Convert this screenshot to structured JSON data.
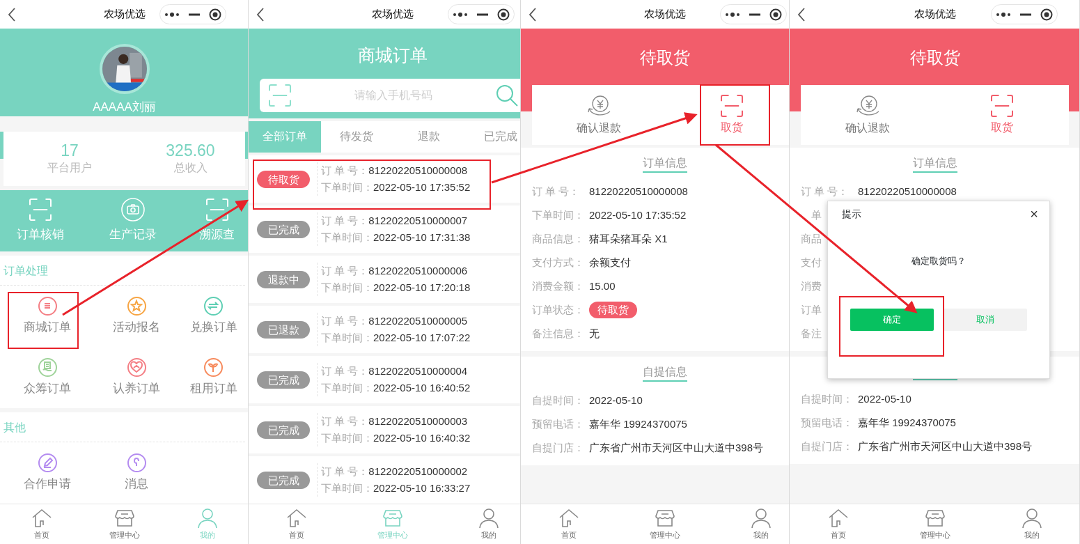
{
  "panels": [
    {
      "kind": "profile",
      "header": {
        "title": "农场优选"
      },
      "profile": {
        "name": "AAAAA刘丽"
      },
      "stats": [
        {
          "value": "17",
          "label": "平台用户"
        },
        {
          "value": "325.60",
          "label": "总收入"
        }
      ],
      "quick_actions": [
        {
          "kind": "scan",
          "label": "订单核销"
        },
        {
          "kind": "camera",
          "label": "生产记录"
        },
        {
          "kind": "scan",
          "label": "溯源查"
        }
      ],
      "sections": [
        {
          "title": "订单处理",
          "items": [
            {
              "kind": "list",
              "label": "商城订单",
              "color": "#f47f85"
            },
            {
              "kind": "star",
              "label": "活动报名",
              "color": "#f7a544"
            },
            {
              "kind": "swap",
              "label": "兑换订单",
              "color": "#5fcfb4"
            },
            {
              "kind": "receipt",
              "label": "众筹订单",
              "color": "#9fd39a"
            },
            {
              "kind": "heart",
              "label": "认养订单",
              "color": "#f47f85"
            },
            {
              "kind": "sprout",
              "label": "租用订单",
              "color": "#f78a5c"
            }
          ]
        },
        {
          "title": "其他",
          "items": [
            {
              "kind": "pen",
              "label": "合作申请",
              "color": "#b48cf0"
            },
            {
              "kind": "bell",
              "label": "消息",
              "color": "#b48cf0"
            }
          ]
        }
      ],
      "tabbar": [
        {
          "label": "首页",
          "selected": false
        },
        {
          "label": "管理中心",
          "selected": false
        },
        {
          "label": "我的",
          "selected": true
        }
      ]
    },
    {
      "kind": "orders",
      "header": {
        "title": "农场优选"
      },
      "title": "商城订单",
      "search": {
        "placeholder": "请输入手机号码"
      },
      "tabs": [
        {
          "label": "全部订单",
          "selected": true
        },
        {
          "label": "待发货",
          "selected": false
        },
        {
          "label": "退款",
          "selected": false
        },
        {
          "label": "已完成",
          "selected": false
        }
      ],
      "orders": [
        {
          "status": "待取货",
          "color": "#f25d6b",
          "number_label": "订 单 号：",
          "number": "81220220510000008",
          "time_label": "下单时间：",
          "time": "2022-05-10 17:35:52"
        },
        {
          "status": "已完成",
          "color": "#999999",
          "number_label": "订 单 号：",
          "number": "81220220510000007",
          "time_label": "下单时间：",
          "time": "2022-05-10 17:31:38"
        },
        {
          "status": "退款中",
          "color": "#999999",
          "number_label": "订 单 号：",
          "number": "81220220510000006",
          "time_label": "下单时间：",
          "time": "2022-05-10 17:20:18"
        },
        {
          "status": "已退款",
          "color": "#999999",
          "number_label": "订 单 号：",
          "number": "81220220510000005",
          "time_label": "下单时间：",
          "time": "2022-05-10 17:07:22"
        },
        {
          "status": "已完成",
          "color": "#999999",
          "number_label": "订 单 号：",
          "number": "81220220510000004",
          "time_label": "下单时间：",
          "time": "2022-05-10 16:40:52"
        },
        {
          "status": "已完成",
          "color": "#999999",
          "number_label": "订 单 号：",
          "number": "81220220510000003",
          "time_label": "下单时间：",
          "time": "2022-05-10 16:40:32"
        },
        {
          "status": "已完成",
          "color": "#999999",
          "number_label": "订 单 号：",
          "number": "81220220510000002",
          "time_label": "下单时间：",
          "time": "2022-05-10 16:33:27"
        }
      ],
      "tabbar": [
        {
          "label": "首页",
          "selected": false
        },
        {
          "label": "管理中心",
          "selected": true
        },
        {
          "label": "我的",
          "selected": false
        }
      ]
    },
    {
      "kind": "detail",
      "header": {
        "title": "农场优选"
      },
      "title": "待取货",
      "actions": [
        {
          "kind": "refund",
          "label": "确认退款",
          "color": "#777777"
        },
        {
          "kind": "scan",
          "label": "取货",
          "color": "#f25d6b"
        }
      ],
      "sections": [
        {
          "title": "订单信息",
          "rows": [
            {
              "kind": "text",
              "label": "订 单 号：",
              "value": "81220220510000008"
            },
            {
              "kind": "text",
              "label": "下单时间：",
              "value": "2022-05-10 17:35:52"
            },
            {
              "kind": "text",
              "label": "商品信息：",
              "value": "猪耳朵猪耳朵 X1"
            },
            {
              "kind": "text",
              "label": "支付方式：",
              "value": "余额支付"
            },
            {
              "kind": "text",
              "label": "消费金额：",
              "value": "15.00"
            },
            {
              "kind": "badge",
              "label": "订单状态：",
              "value": "待取货"
            },
            {
              "kind": "text",
              "label": "备注信息：",
              "value": "无"
            }
          ]
        },
        {
          "title": "自提信息",
          "rows": [
            {
              "kind": "text",
              "label": "自提时间：",
              "value": "2022-05-10"
            },
            {
              "kind": "text",
              "label": "预留电话：",
              "value": "嘉年华 19924370075"
            },
            {
              "kind": "text",
              "label": "自提门店：",
              "value": "广东省广州市天河区中山大道中398号"
            }
          ]
        }
      ],
      "tabbar": [
        {
          "label": "首页",
          "selected": false
        },
        {
          "label": "管理中心",
          "selected": false
        },
        {
          "label": "我的",
          "selected": false
        }
      ]
    },
    {
      "kind": "detail",
      "header": {
        "title": "农场优选"
      },
      "title": "待取货",
      "actions": [
        {
          "kind": "refund",
          "label": "确认退款",
          "color": "#777777"
        },
        {
          "kind": "scan",
          "label": "取货",
          "color": "#f25d6b"
        }
      ],
      "sections": [
        {
          "title": "订单信息",
          "rows": [
            {
              "kind": "text",
              "label": "订 单 号：",
              "value": "81220220510000008"
            },
            {
              "kind": "covered",
              "label": "单"
            },
            {
              "label": "商品"
            },
            {
              "label": "支付"
            },
            {
              "label": "消费"
            },
            {
              "label": "订单"
            },
            {
              "label": "备注"
            }
          ]
        },
        {
          "rows": [
            {
              "kind": "text",
              "label": "自提时间：",
              "value": "2022-05-10"
            },
            {
              "kind": "text",
              "label": "预留电话：",
              "value": "嘉年华 19924370075"
            },
            {
              "kind": "text",
              "label": "自提门店：",
              "value": "广东省广州市天河区中山大道中398号"
            }
          ]
        }
      ],
      "dialog": {
        "title": "提示",
        "close": "×",
        "message": "确定取货吗？",
        "buttons": [
          {
            "kind": "primary",
            "label": "确定"
          },
          {
            "kind": "secondary",
            "label": "取消"
          }
        ]
      },
      "tabbar": [
        {
          "label": "首页",
          "selected": false
        },
        {
          "label": "管理中心",
          "selected": false
        },
        {
          "label": "我的",
          "selected": false
        }
      ]
    }
  ]
}
